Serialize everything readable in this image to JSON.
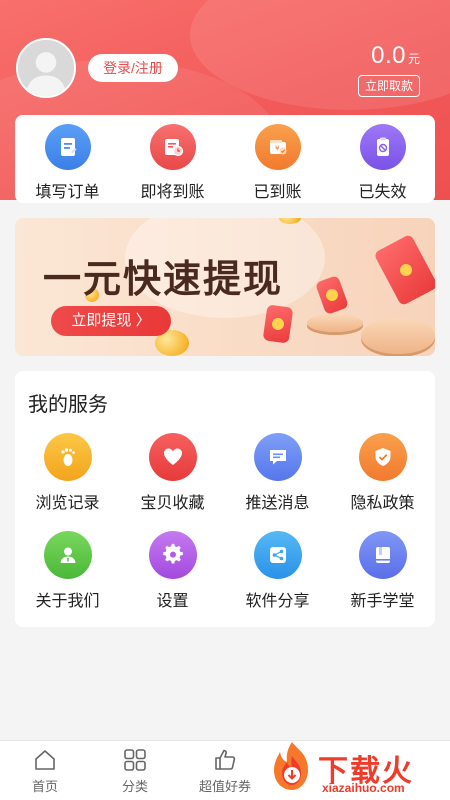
{
  "header": {
    "login_label": "登录/注册",
    "balance_amount": "0.0",
    "balance_unit": "元",
    "withdraw_label": "立即取款"
  },
  "orders": [
    {
      "label": "填写订单",
      "icon": "edit-document-icon",
      "color": "#4a8ff0"
    },
    {
      "label": "即将到账",
      "icon": "clock-calendar-icon",
      "color": "#f05a5a"
    },
    {
      "label": "已到账",
      "icon": "wallet-check-icon",
      "color": "#f58a3a"
    },
    {
      "label": "已失效",
      "icon": "invalid-clipboard-icon",
      "color": "#8b62f0"
    }
  ],
  "banner": {
    "title": "一元快速提现",
    "button_label": "立即提现 〉"
  },
  "services": {
    "title": "我的服务",
    "items": [
      {
        "label": "浏览记录",
        "icon": "footprint-icon",
        "color": "#f6b42a"
      },
      {
        "label": "宝贝收藏",
        "icon": "heart-icon",
        "color": "#f04848"
      },
      {
        "label": "推送消息",
        "icon": "message-icon",
        "color": "#6a8ef5"
      },
      {
        "label": "隐私政策",
        "icon": "shield-check-icon",
        "color": "#f58a3a"
      },
      {
        "label": "关于我们",
        "icon": "user-icon",
        "color": "#5cc94a"
      },
      {
        "label": "设置",
        "icon": "gear-icon",
        "color": "#b45ae6"
      },
      {
        "label": "软件分享",
        "icon": "share-icon",
        "color": "#3aa6ef"
      },
      {
        "label": "新手学堂",
        "icon": "book-icon",
        "color": "#6a80f0"
      }
    ]
  },
  "bottom_nav": [
    {
      "label": "首页",
      "icon": "home-icon"
    },
    {
      "label": "分类",
      "icon": "grid-icon"
    },
    {
      "label": "超值好券",
      "icon": "thumbs-up-icon"
    }
  ],
  "watermark": {
    "title": "下载火",
    "subtitle": "xiazaihuo.com"
  }
}
